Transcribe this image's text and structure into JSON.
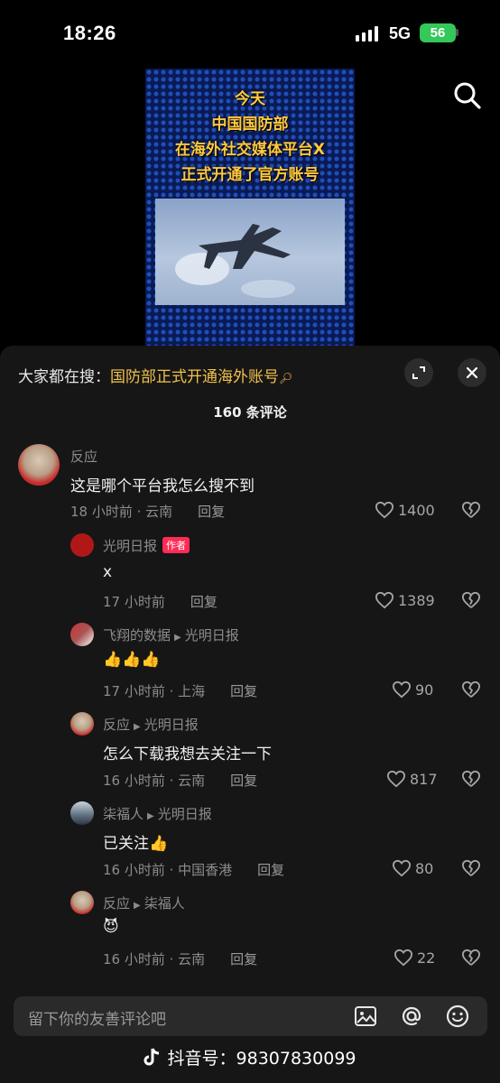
{
  "status": {
    "time": "18:26",
    "network": "5G",
    "battery": "56"
  },
  "video": {
    "caption_lines": [
      "今天",
      "中国国防部",
      "在海外社交媒体平台X",
      "正式开通了官方账号"
    ]
  },
  "search_bar": {
    "label": "大家都在搜：",
    "query": "国防部正式开通海外账号"
  },
  "comment_count": "160 条评论",
  "reply_label": "回复",
  "comments": [
    {
      "user": "反应",
      "text": "这是哪个平台我怎么搜不到",
      "meta": "18 小时前 · 云南",
      "likes": "1400"
    },
    {
      "user": "光明日报",
      "author_tag": "作者",
      "text": "x",
      "meta": "17 小时前",
      "likes": "1389"
    },
    {
      "user": "飞翔的数据",
      "reply_to": "光明日报",
      "text": "👍👍👍",
      "meta": "17 小时前 · 上海",
      "likes": "90"
    },
    {
      "user": "反应",
      "reply_to": "光明日报",
      "text": "怎么下载我想去关注一下",
      "meta": "16 小时前 · 云南",
      "likes": "817"
    },
    {
      "user": "柒福人",
      "reply_to": "光明日报",
      "text": "已关注👍",
      "meta": "16 小时前 · 中国香港",
      "likes": "80"
    },
    {
      "user": "反应",
      "reply_to": "柒福人",
      "text": "😈",
      "meta": "16 小时前 · 云南",
      "likes": "22"
    }
  ],
  "input": {
    "placeholder": "留下你的友善评论吧"
  },
  "watermark": "抖音号：98307830099",
  "colors": {
    "accent_red": "#fe2c55",
    "highlight_yellow": "#f2c14a",
    "sheet_bg": "#161616"
  }
}
